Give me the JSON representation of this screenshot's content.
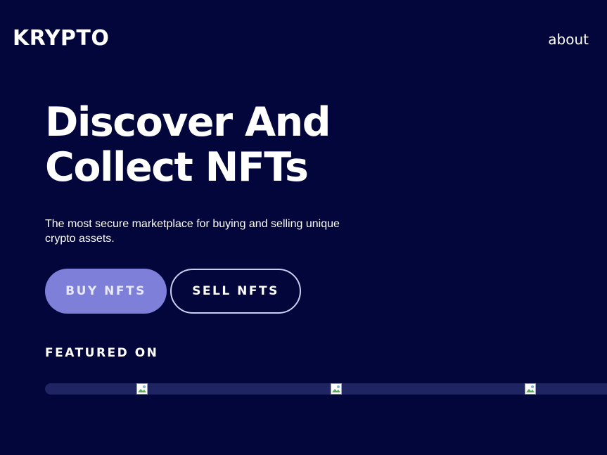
{
  "nav": {
    "logo": "KRYPTO",
    "about": "about"
  },
  "hero": {
    "title_line1": "Discover And",
    "title_line2": "Collect NFTs",
    "subtitle": "The most secure marketplace for buying and selling unique crypto assets."
  },
  "buttons": {
    "buy": "BUY NFTS",
    "sell": "SELL NFTS"
  },
  "featured": {
    "heading": "FEATURED ON",
    "logos": [
      {
        "icon": "broken-image-icon"
      },
      {
        "icon": "broken-image-icon"
      },
      {
        "icon": "broken-image-icon"
      }
    ]
  },
  "colors": {
    "background": "#02063a",
    "accent": "#7d7fd9",
    "strip": "#1f2563",
    "text": "#ffffff"
  }
}
